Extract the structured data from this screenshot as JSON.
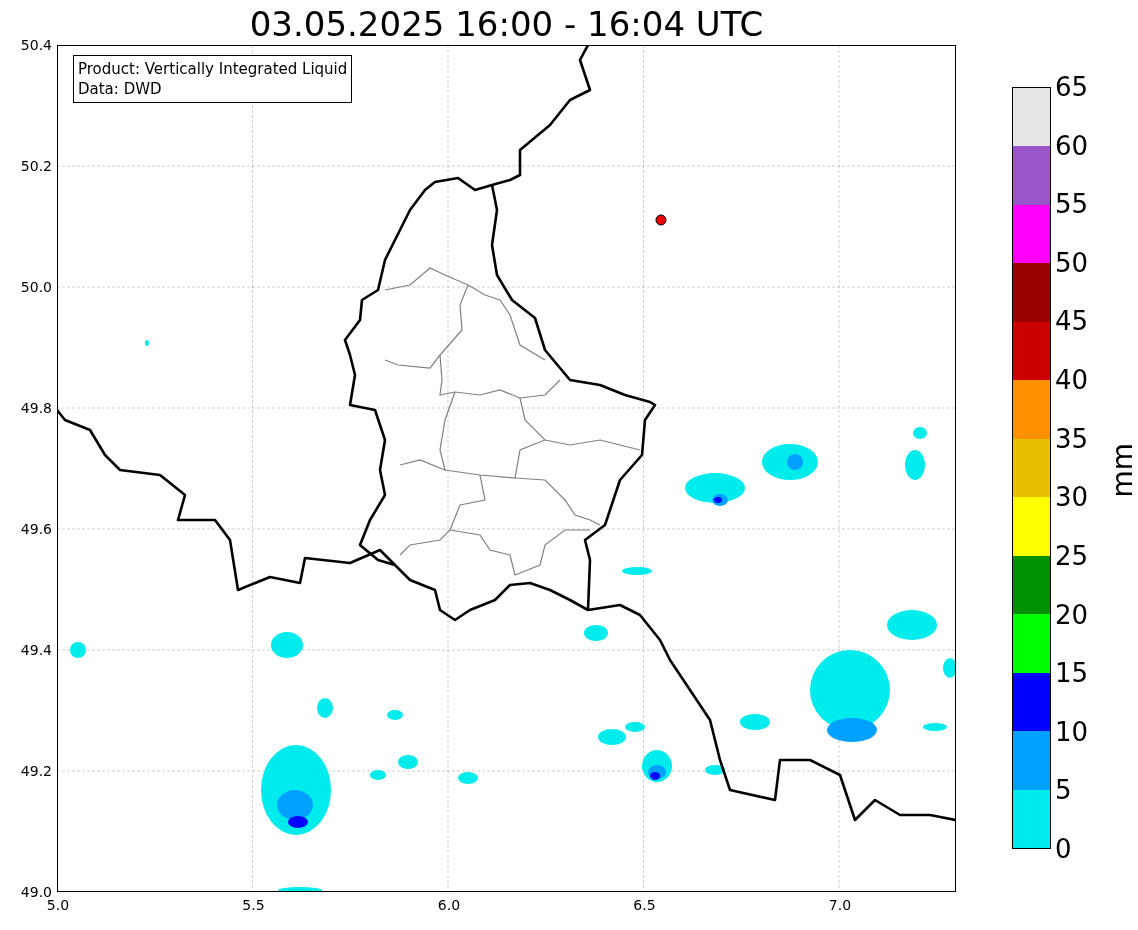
{
  "title": "03.05.2025 16:00 - 16:04 UTC",
  "info_box": [
    "Product: Vertically Integrated Liquid",
    "Data: DWD"
  ],
  "map": {
    "x_ticks": [
      "5.0",
      "5.5",
      "6.0",
      "6.5",
      "7.0"
    ],
    "y_ticks": [
      "50.4",
      "50.2",
      "50.0",
      "49.8",
      "49.6",
      "49.4",
      "49.2",
      "49.0"
    ]
  },
  "colorbar": {
    "label": "mm",
    "ticks": [
      "65",
      "60",
      "55",
      "50",
      "45",
      "40",
      "35",
      "30",
      "25",
      "20",
      "15",
      "10",
      "5",
      "0"
    ],
    "segments": [
      {
        "color": "#e5e5e5"
      },
      {
        "color": "#9955c9"
      },
      {
        "color": "#ff00ff"
      },
      {
        "color": "#990000"
      },
      {
        "color": "#cc0000"
      },
      {
        "color": "#ff9000"
      },
      {
        "color": "#e7c000"
      },
      {
        "color": "#ffff00"
      },
      {
        "color": "#009000"
      },
      {
        "color": "#00ff00"
      },
      {
        "color": "#0000ff"
      },
      {
        "color": "#00a0ff"
      },
      {
        "color": "#00ebeb"
      }
    ]
  }
}
